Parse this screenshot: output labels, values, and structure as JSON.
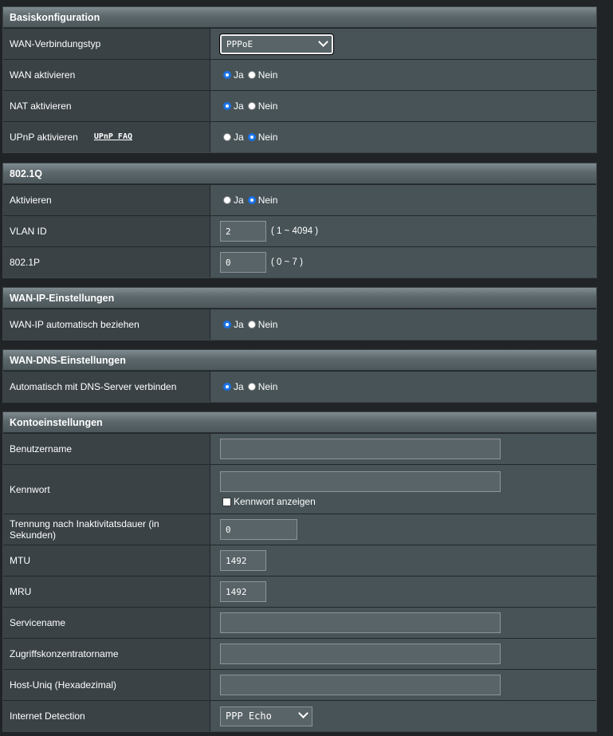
{
  "basic": {
    "title": "Basiskonfiguration",
    "wan_type_label": "WAN-Verbindungstyp",
    "wan_type_value": "PPPoE",
    "wan_enable_label": "WAN aktivieren",
    "nat_enable_label": "NAT aktivieren",
    "upnp_enable_label": "UPnP aktivieren",
    "upnp_faq": "UPnP FAQ"
  },
  "common": {
    "yes": "Ja",
    "no": "Nein"
  },
  "dot1q": {
    "title": "802.1Q",
    "enable_label": "Aktivieren",
    "vlan_label": "VLAN ID",
    "vlan_value": "2",
    "vlan_range": "( 1 ~ 4094 )",
    "prio_label": "802.1P",
    "prio_value": "0",
    "prio_range": "( 0 ~ 7 )"
  },
  "wanip": {
    "title": "WAN-IP-Einstellungen",
    "auto_label": "WAN-IP automatisch beziehen"
  },
  "wandns": {
    "title": "WAN-DNS-Einstellungen",
    "auto_label": "Automatisch mit DNS-Server verbinden"
  },
  "account": {
    "title": "Kontoeinstellungen",
    "username_label": "Benutzername",
    "username_value": "",
    "password_label": "Kennwort",
    "password_value": "",
    "show_password_label": "Kennwort anzeigen",
    "idle_label": "Trennung nach Inaktivitatsdauer (in Sekunden)",
    "idle_value": "0",
    "mtu_label": "MTU",
    "mtu_value": "1492",
    "mru_label": "MRU",
    "mru_value": "1492",
    "service_label": "Servicename",
    "service_value": "",
    "ac_label": "Zugriffskonzentratorname",
    "ac_value": "",
    "hostuniq_label": "Host-Uniq (Hexadezimal)",
    "hostuniq_value": "",
    "detect_label": "Internet Detection",
    "detect_value": "PPP Echo"
  },
  "radio_state": {
    "wan_enable": "Ja",
    "nat_enable": "Ja",
    "upnp_enable": "Nein",
    "dot1q_enable": "Nein",
    "wanip_auto": "Ja",
    "wandns_auto": "Ja"
  }
}
